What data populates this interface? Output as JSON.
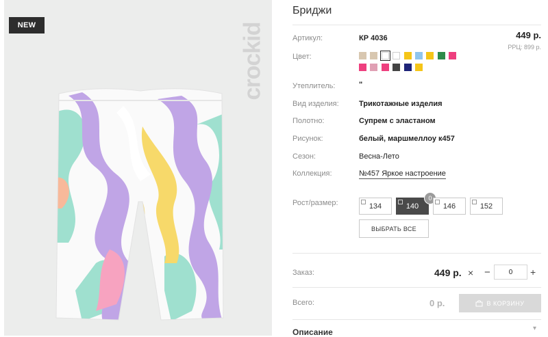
{
  "product": {
    "badge": "NEW",
    "brand": "crockid",
    "title": "Бриджи"
  },
  "specs": {
    "article_label": "Артикул:",
    "article_value": "КР 4036",
    "color_label": "Цвет:",
    "insulation_label": "Утеплитель:",
    "insulation_value": "\"",
    "type_label": "Вид изделия:",
    "type_value": "Трикотажные изделия",
    "fabric_label": "Полотно:",
    "fabric_value": "Супрем с эластаном",
    "pattern_label": "Рисунок:",
    "pattern_value": "белый, маршмеллоу к457",
    "season_label": "Сезон:",
    "season_value": "Весна-Лето",
    "collection_label": "Коллекция:",
    "collection_value": "№457 Яркое настроение"
  },
  "price": {
    "main": "449 р.",
    "rrc": "РРЦ: 899 р."
  },
  "colors": [
    "#d8c7b0",
    "#d8c7b0",
    "#ffffff",
    "#ffffff",
    "#f5c518",
    "#8fc5ee",
    "#f5c518",
    "#2e8b4a",
    "#ee3f7e",
    "#ee3f7e",
    "#e0a0b4",
    "#ee3f7e",
    "#444444",
    "#1e2478",
    "#f5c518"
  ],
  "sizes": {
    "label": "Рост/размер:",
    "options": [
      "134",
      "140",
      "146",
      "152"
    ],
    "selected_count": "0",
    "select_all": "ВЫБРАТЬ ВСЕ"
  },
  "order": {
    "label": "Заказ:",
    "price": "449 р.",
    "times": "×",
    "minus": "−",
    "qty": "0",
    "plus": "+"
  },
  "total": {
    "label": "Всего:",
    "value": "0 р.",
    "cart_button": "В КОРЗИНУ"
  },
  "description": {
    "label": "Описание"
  }
}
